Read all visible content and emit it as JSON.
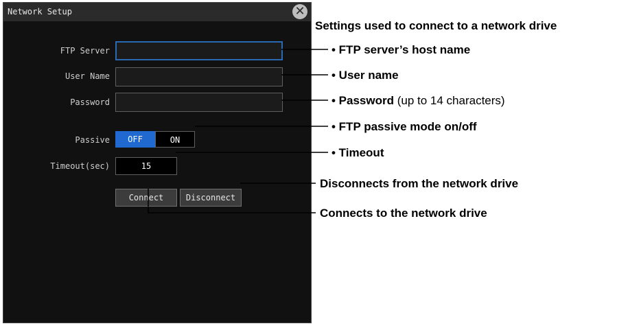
{
  "dialog": {
    "title": "Network Setup",
    "close_icon": "close-icon"
  },
  "form": {
    "ftp_server_label": "FTP Server",
    "ftp_server_value": "",
    "user_name_label": "User Name",
    "user_name_value": "",
    "password_label": "Password",
    "password_value": "",
    "passive_label": "Passive",
    "passive_off": "OFF",
    "passive_on": "ON",
    "passive_selected": "OFF",
    "timeout_label": "Timeout(sec)",
    "timeout_value": "15",
    "connect_label": "Connect",
    "disconnect_label": "Disconnect"
  },
  "annotations": {
    "heading": "Settings used to connect to a network drive",
    "ftp_server": "• FTP server’s host name",
    "user_name": "• User name",
    "password_bold": "• Password",
    "password_rest": " (up to 14 characters)",
    "passive": "• FTP passive mode on/off",
    "timeout": "• Timeout",
    "disconnect": "Disconnects from the network drive",
    "connect": "Connects to the network drive"
  },
  "colors": {
    "selected_toggle": "#1f69d1",
    "active_field_border": "#2a6ab3"
  }
}
